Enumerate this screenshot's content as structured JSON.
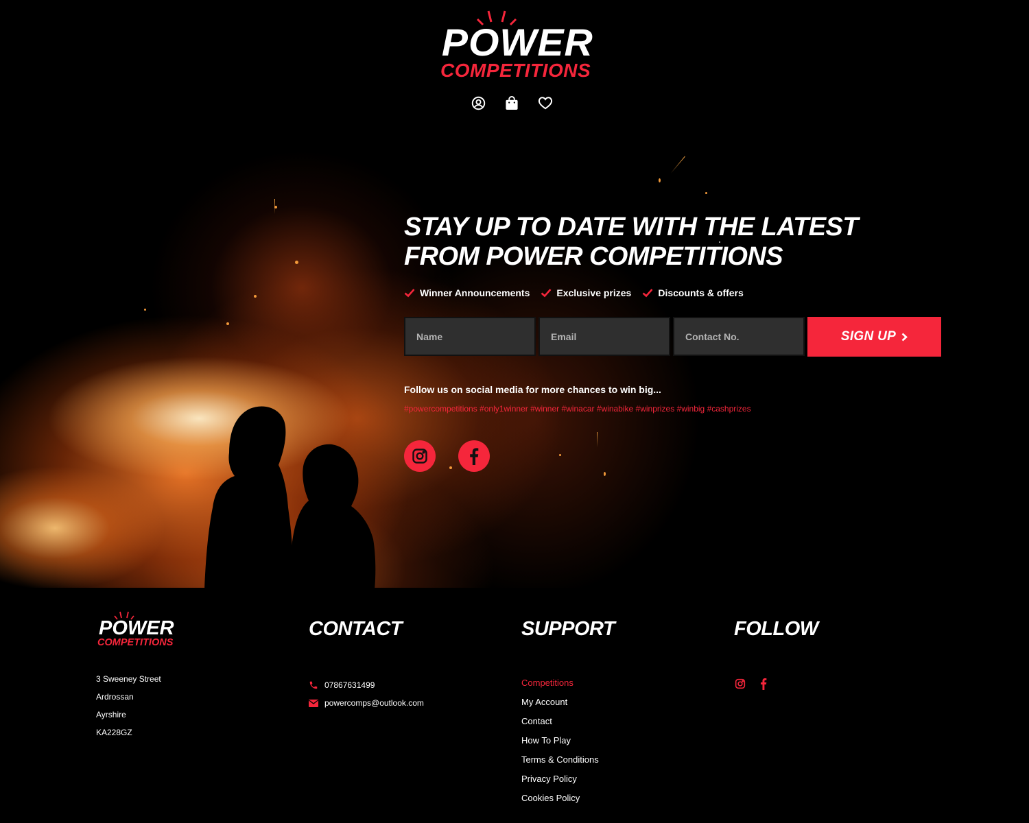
{
  "brand": {
    "line1": "POWER",
    "line2": "COMPETITIONS",
    "accent_color": "#f5263b"
  },
  "header": {
    "icons": [
      {
        "name": "account-icon",
        "label": "Account"
      },
      {
        "name": "shopping-bag-icon",
        "label": "Basket"
      },
      {
        "name": "heart-icon",
        "label": "Wishlist"
      }
    ]
  },
  "hero": {
    "title": "STAY UP TO DATE WITH THE LATEST FROM POWER COMPETITIONS",
    "perks": [
      "Winner Announcements",
      "Exclusive prizes",
      "Discounts & offers"
    ],
    "form": {
      "name_placeholder": "Name",
      "email_placeholder": "Email",
      "contact_placeholder": "Contact No.",
      "name_value": "",
      "email_value": "",
      "contact_value": "",
      "submit_label": "SIGN UP",
      "submit_icon": "chevron-right-icon"
    },
    "follow_text": "Follow us on social media for more chances to win big...",
    "hashtags": "#powercompetitions #only1winner #winner #winacar #winabike #winprizes #winbig #cashprizes",
    "socials": [
      {
        "name": "instagram-icon",
        "label": "Instagram"
      },
      {
        "name": "facebook-icon",
        "label": "Facebook"
      }
    ]
  },
  "footer": {
    "address": [
      "3 Sweeney Street",
      "Ardrossan",
      "Ayrshire",
      "KA228GZ"
    ],
    "contact": {
      "heading": "CONTACT",
      "phone": "07867631499",
      "email": "powercomps@outlook.com"
    },
    "support": {
      "heading": "SUPPORT",
      "links": [
        {
          "label": "Competitions",
          "active": true
        },
        {
          "label": "My Account",
          "active": false
        },
        {
          "label": "Contact",
          "active": false
        },
        {
          "label": "How To Play",
          "active": false
        },
        {
          "label": "Terms & Conditions",
          "active": false
        },
        {
          "label": "Privacy Policy",
          "active": false
        },
        {
          "label": "Cookies Policy",
          "active": false
        }
      ]
    },
    "follow": {
      "heading": "FOLLOW",
      "icons": [
        "instagram-icon",
        "facebook-icon"
      ]
    }
  }
}
